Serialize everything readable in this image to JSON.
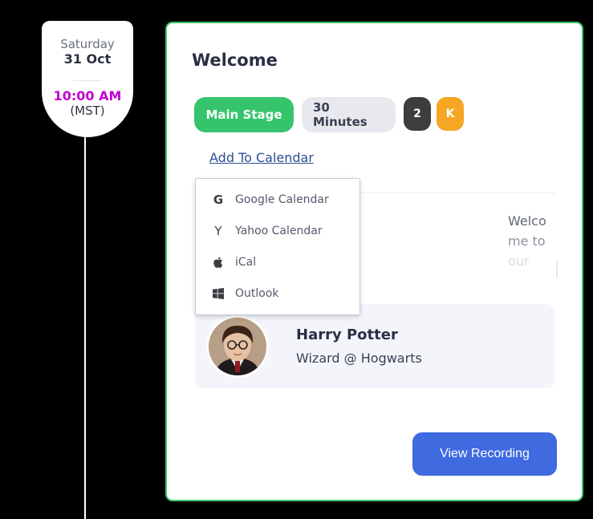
{
  "timeline": {
    "day": "Saturday",
    "date": "31 Oct",
    "time": "10:00 AM",
    "timezone": "(MST)"
  },
  "session": {
    "title": "Welcome",
    "chips": {
      "stage": "Main Stage",
      "duration": "30 Minutes",
      "count": "2",
      "initial": "K"
    },
    "add_to_calendar": "Add To Calendar",
    "description": {
      "line1": "Welco",
      "line2": "me to",
      "line3": "our"
    },
    "speaker": {
      "name": "Harry Potter",
      "role": "Wizard @ Hogwarts"
    },
    "view_recording": "View Recording"
  },
  "calendar_menu": {
    "items": [
      {
        "label": "Google Calendar",
        "icon": "google-icon"
      },
      {
        "label": "Yahoo Calendar",
        "icon": "yahoo-icon"
      },
      {
        "label": "iCal",
        "icon": "apple-icon"
      },
      {
        "label": "Outlook",
        "icon": "windows-icon"
      }
    ]
  },
  "colors": {
    "card_border": "#3ec46f",
    "stage_chip": "#35c46c",
    "time_accent": "#c100d2",
    "primary_button": "#3f6ae0",
    "initial_chip": "#f5a623"
  }
}
